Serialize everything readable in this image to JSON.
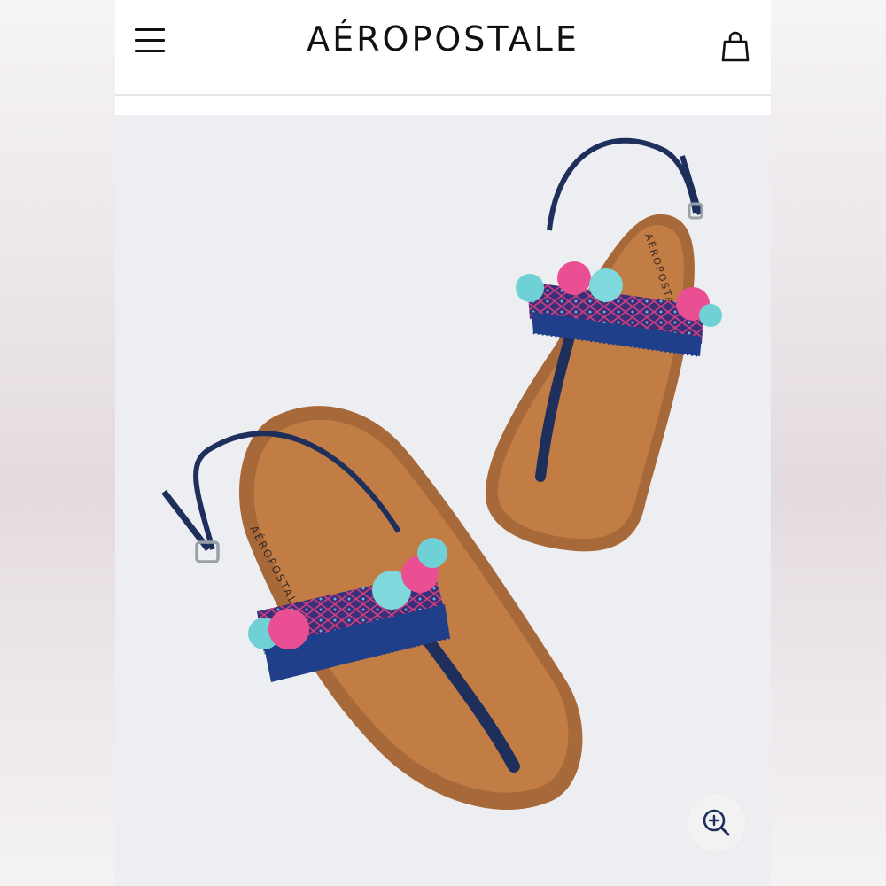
{
  "header": {
    "brand": "AÉROPOSTALE",
    "menu_icon": "hamburger-menu-icon",
    "bag_icon": "shopping-bag-icon"
  },
  "product_image": {
    "insole_print": "AÉROPOSTALE",
    "zoom_icon": "zoom-in-icon"
  },
  "colors": {
    "navy": "#1f2f5c",
    "tan": "#b8743f",
    "pink": "#e94f92",
    "teal": "#6fd1d6"
  }
}
